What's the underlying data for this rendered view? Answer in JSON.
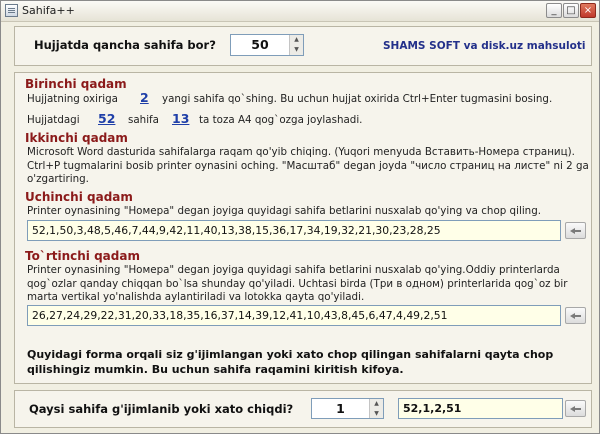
{
  "window": {
    "title": "Sahifa++",
    "controls": {
      "minimize": "_",
      "maximize": "□",
      "close": "×"
    }
  },
  "top": {
    "question": "Hujjatda qancha sahifa bor?",
    "page_count": "50",
    "brand": "SHAMS SOFT va disk.uz mahsuloti"
  },
  "step1": {
    "heading": "Birinchi qadam",
    "line1_a": "Hujjatning oxiriga",
    "add_pages": "2",
    "line1_b": "yangi sahifa qo`shing. Bu uchun hujjat oxirida Ctrl+Enter tugmasini bosing.",
    "line2_a": "Hujjatdagi",
    "total_pages": "52",
    "line2_b": "sahifa",
    "sheets": "13",
    "line2_c": "ta toza A4 qog`ozga joylashadi."
  },
  "step2": {
    "heading": "Ikkinchi qadam",
    "text": "Microsoft Word dasturida sahifalarga raqam qo'yib chiqing. (Yuqori menyuda Вставить-Номера страниц). Ctrl+P tugmalarini bosib printer oynasini oching. \"Масштаб\" degan joyda \"число страниц на листе\" ni 2 ga o'zgartiring."
  },
  "step3": {
    "heading": "Uchinchi qadam",
    "text": "Printer oynasining \"Номера\" degan joyiga quyidagi sahifa betlarini nusxalab qo'ying va chop qiling.",
    "pages": "52,1,50,3,48,5,46,7,44,9,42,11,40,13,38,15,36,17,34,19,32,21,30,23,28,25"
  },
  "step4": {
    "heading": "To`rtinchi qadam",
    "text": "Printer oynasining \"Номера\" degan joyiga quyidagi sahifa betlarini nusxalab qo'ying.Oddiy printerlarda qog`ozlar qanday chiqqan bo`lsa shunday qo'yiladi. Uchtasi birda (Три в одном) printerlarida qog`oz bir marta vertikal yo'nalishda aylantiriladi va lotokka qayta qo'yiladi.",
    "pages": "26,27,24,29,22,31,20,33,18,35,16,37,14,39,12,41,10,43,8,45,6,47,4,49,2,51"
  },
  "info": {
    "text": "Quyidagi forma orqali siz g'ijimlangan yoki xato chop qilingan sahifalarni qayta chop qilishingiz mumkin. Bu uchun sahifa raqamini kiritish kifoya."
  },
  "bottom": {
    "question": "Qaysi sahifa g'ijimlanib yoki xato chiqdi?",
    "spinner_value": "1",
    "result": "52,1,2,51"
  }
}
